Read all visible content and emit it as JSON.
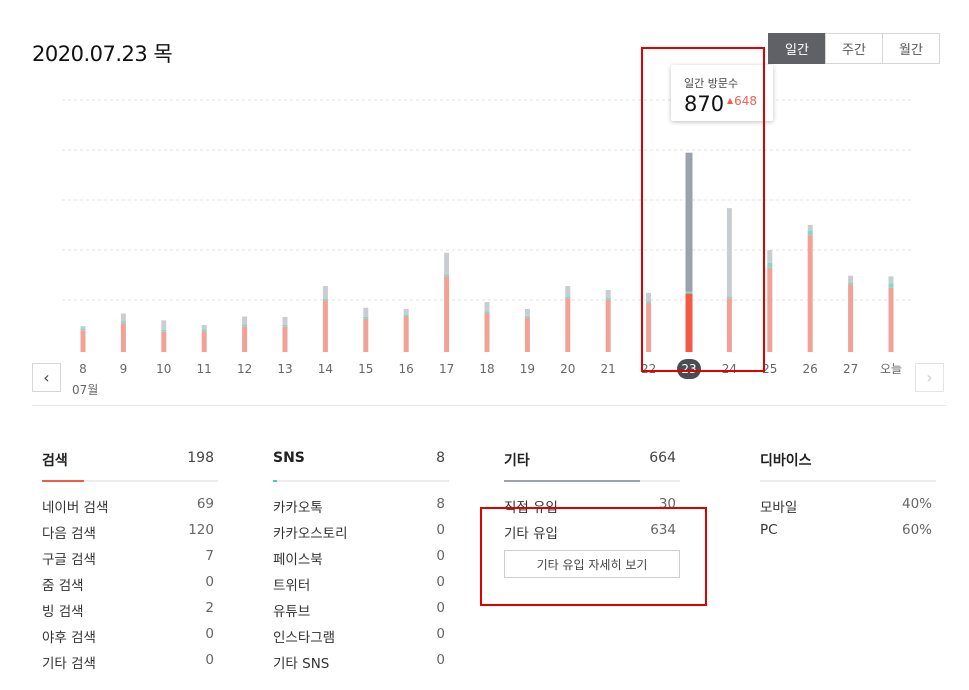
{
  "header": {
    "date": "2020.07.23 목",
    "tabs": [
      {
        "label": "일간",
        "active": true
      },
      {
        "label": "주간",
        "active": false
      },
      {
        "label": "월간",
        "active": false
      }
    ]
  },
  "tooltip": {
    "label": "일간 방문수",
    "value": "870",
    "delta": "648"
  },
  "chart_data": {
    "type": "bar",
    "stacked": true,
    "month_label": "07월",
    "selected": "23",
    "grid": true,
    "ylim": [
      0,
      1100
    ],
    "categories": [
      "8",
      "9",
      "10",
      "11",
      "12",
      "13",
      "14",
      "15",
      "16",
      "17",
      "18",
      "19",
      "20",
      "21",
      "22",
      "23",
      "24",
      "25",
      "26",
      "27",
      "오늘"
    ],
    "series": [
      {
        "values": [
          95,
          125,
          88,
          90,
          112,
          110,
          225,
          145,
          155,
          330,
          170,
          150,
          235,
          228,
          215,
          255,
          235,
          370,
          510,
          295,
          280
        ],
        "color": "#f2a196"
      },
      {
        "values": [
          8,
          8,
          8,
          8,
          8,
          8,
          8,
          8,
          8,
          8,
          8,
          8,
          8,
          8,
          8,
          8,
          8,
          20,
          20,
          8,
          20
        ],
        "color": "#7fd8c8"
      },
      {
        "values": [
          10,
          35,
          42,
          20,
          35,
          35,
          55,
          40,
          25,
          95,
          40,
          30,
          45,
          35,
          35,
          607,
          385,
          55,
          25,
          30,
          30
        ],
        "color": "#c9ccd1"
      }
    ],
    "selected_colors": [
      "#f25a46",
      "#7fd8c8",
      "#9ba2ab"
    ]
  },
  "navigation": {
    "prev_icon": "‹",
    "next_icon": "›"
  },
  "detail_button": "기타 유입 자세히 보기",
  "columns": [
    {
      "title": "검색",
      "total": "198",
      "underline_color": "#f25a46",
      "rows": [
        {
          "label": "네이버 검색",
          "value": "69"
        },
        {
          "label": "다음 검색",
          "value": "120"
        },
        {
          "label": "구글 검색",
          "value": "7"
        },
        {
          "label": "줌 검색",
          "value": "0"
        },
        {
          "label": "빙 검색",
          "value": "2"
        },
        {
          "label": "야후 검색",
          "value": "0"
        },
        {
          "label": "기타 검색",
          "value": "0"
        }
      ]
    },
    {
      "title": "SNS",
      "total": "8",
      "underline_color": "#4fc9b4",
      "rows": [
        {
          "label": "카카오톡",
          "value": "8"
        },
        {
          "label": "카카오스토리",
          "value": "0"
        },
        {
          "label": "페이스북",
          "value": "0"
        },
        {
          "label": "트위터",
          "value": "0"
        },
        {
          "label": "유튜브",
          "value": "0"
        },
        {
          "label": "인스타그램",
          "value": "0"
        },
        {
          "label": "기타 SNS",
          "value": "0"
        }
      ]
    },
    {
      "title": "기타",
      "total": "664",
      "underline_color": "#9ba2ab",
      "rows": [
        {
          "label": "직접 유입",
          "value": "30"
        },
        {
          "label": "기타 유입",
          "value": "634"
        }
      ]
    },
    {
      "title": "디바이스",
      "total": "",
      "underline_color": "",
      "rows": [
        {
          "label": "모바일",
          "value": "40%"
        },
        {
          "label": "PC",
          "value": "60%"
        }
      ]
    }
  ]
}
